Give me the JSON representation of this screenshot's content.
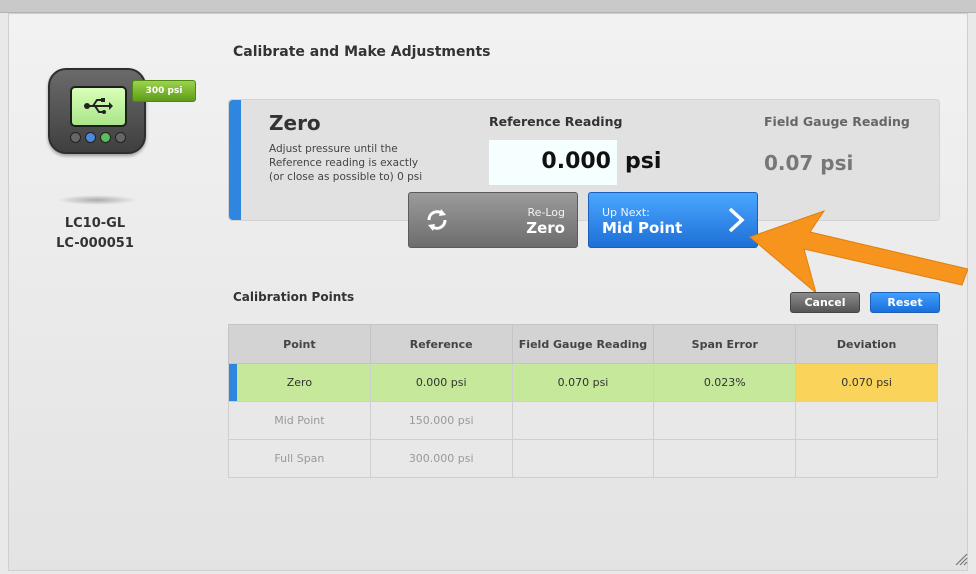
{
  "device": {
    "badge": "300 psi",
    "name": "LC10-GL",
    "serial": "LC-000051"
  },
  "page_title": "Calibrate and Make Adjustments",
  "step": {
    "title": "Zero",
    "instruction": "Adjust pressure until the Reference reading is exactly (or close as possible to) 0 psi",
    "reference_label": "Reference Reading",
    "reference_value": "0.000",
    "reference_unit": "psi",
    "field_label": "Field Gauge Reading",
    "field_value": "0.07 psi"
  },
  "buttons": {
    "relog_small": "Re-Log",
    "relog_big": "Zero",
    "next_small": "Up Next:",
    "next_big": "Mid Point",
    "cancel": "Cancel",
    "reset": "Reset"
  },
  "calibration": {
    "title": "Calibration Points",
    "columns": [
      "Point",
      "Reference",
      "Field Gauge Reading",
      "Span Error",
      "Deviation"
    ],
    "rows": [
      [
        "Zero",
        "0.000 psi",
        "0.070 psi",
        "0.023%",
        "0.070 psi"
      ],
      [
        "Mid Point",
        "150.000 psi",
        "",
        "",
        ""
      ],
      [
        "Full Span",
        "300.000 psi",
        "",
        "",
        ""
      ]
    ]
  },
  "colors": {
    "accent": "#2e86de",
    "active_row": "#c5e89a",
    "deviation": "#f9d35a",
    "arrow": "#f7941d"
  }
}
